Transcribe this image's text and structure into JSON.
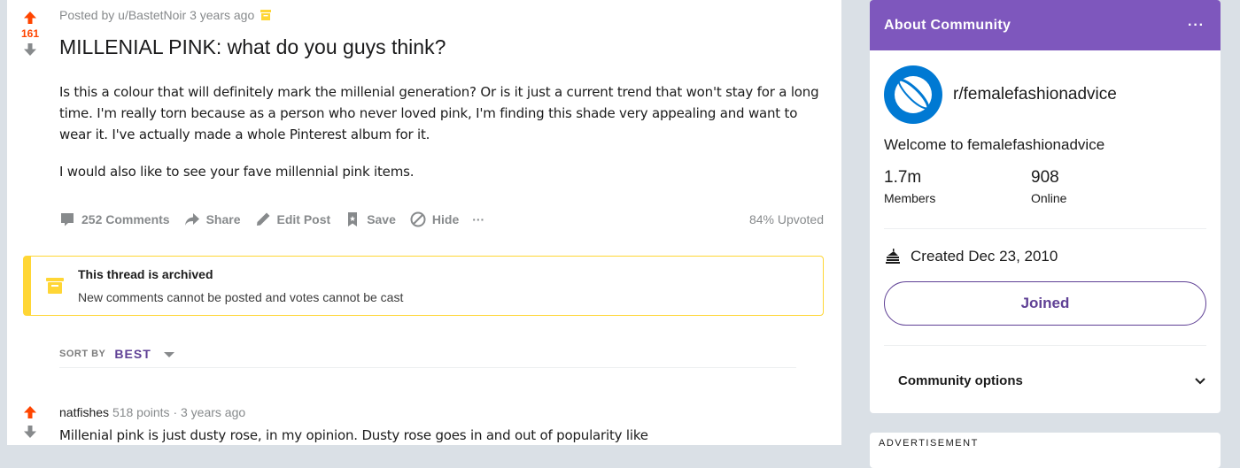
{
  "post": {
    "score": "161",
    "meta": "Posted by u/BastetNoir 3 years ago",
    "archived_icon": "archive-icon",
    "title": "MILLENIAL PINK: what do you guys think?",
    "body": [
      "Is this a colour that will definitely mark the millenial generation? Or is it just a current trend that won't stay for a long time. I'm really torn because as a person who never loved pink, I'm finding this shade very appealing and want to wear it. I've actually made a whole Pinterest album for it.",
      "I would also like to see your fave millennial pink items."
    ],
    "actions": {
      "comments": "252 Comments",
      "share": "Share",
      "edit": "Edit Post",
      "save": "Save",
      "hide": "Hide",
      "more": "···"
    },
    "upvoted": "84% Upvoted"
  },
  "archive_notice": {
    "title": "This thread is archived",
    "subtitle": "New comments cannot be posted and votes cannot be cast"
  },
  "sort": {
    "label": "SORT BY",
    "value": "BEST"
  },
  "comment": {
    "author": "natfishes",
    "points": "518 points",
    "separator": "·",
    "time": "3 years ago",
    "text": "Millenial pink is just dusty rose, in my opinion. Dusty rose goes in and out of popularity like"
  },
  "sidebar": {
    "header_title": "About Community",
    "header_more": "···",
    "community_name": "r/femalefashionadvice",
    "welcome": "Welcome to femalefashionadvice",
    "members_count": "1.7m",
    "members_label": "Members",
    "online_count": "908",
    "online_label": "Online",
    "created": "Created Dec 23, 2010",
    "joined_label": "Joined",
    "options_label": "Community options",
    "ad_label": "ADVERTISEMENT"
  },
  "colors": {
    "upvote": "#ff4500",
    "downvote": "#878a8c",
    "header_purple": "#7e57bd",
    "joined_purple": "#5f4095",
    "archive_yellow": "#ffd635",
    "community_icon_blue": "#0079d3"
  }
}
